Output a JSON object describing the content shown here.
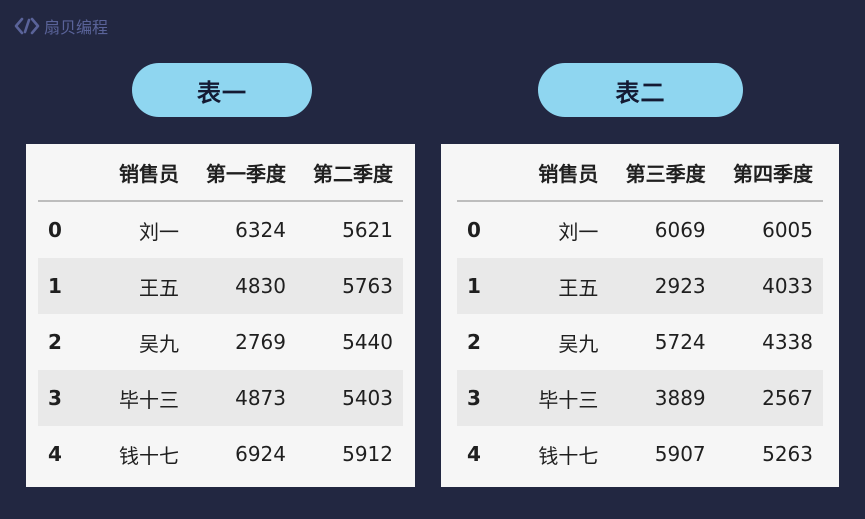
{
  "brand": {
    "name": "扇贝编程",
    "icon": "code-bracket-logo-icon",
    "color": "#5a6399"
  },
  "colors": {
    "background": "#222741",
    "pill": "#8fd6f0",
    "panel": "#f6f6f6",
    "row_alt": "#e9e9e9"
  },
  "tables": [
    {
      "title": "表一",
      "columns": [
        "",
        "销售员",
        "第一季度",
        "第二季度"
      ],
      "rows": [
        [
          "0",
          "刘一",
          "6324",
          "5621"
        ],
        [
          "1",
          "王五",
          "4830",
          "5763"
        ],
        [
          "2",
          "吴九",
          "2769",
          "5440"
        ],
        [
          "3",
          "毕十三",
          "4873",
          "5403"
        ],
        [
          "4",
          "钱十七",
          "6924",
          "5912"
        ]
      ]
    },
    {
      "title": "表二",
      "columns": [
        "",
        "销售员",
        "第三季度",
        "第四季度"
      ],
      "rows": [
        [
          "0",
          "刘一",
          "6069",
          "6005"
        ],
        [
          "1",
          "王五",
          "2923",
          "4033"
        ],
        [
          "2",
          "吴九",
          "5724",
          "4338"
        ],
        [
          "3",
          "毕十三",
          "3889",
          "2567"
        ],
        [
          "4",
          "钱十七",
          "5907",
          "5263"
        ]
      ]
    }
  ]
}
